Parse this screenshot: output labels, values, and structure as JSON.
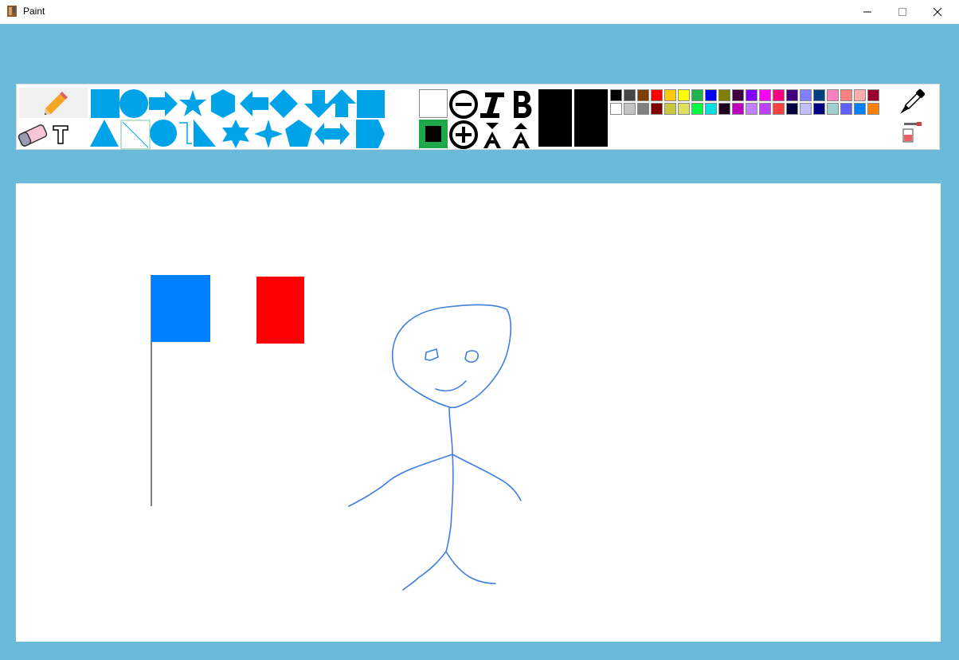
{
  "window": {
    "title": "Paint"
  },
  "colors": {
    "accent": "#00a2e8",
    "canvas_bg": "#ffffff",
    "app_bg": "#6cbad9",
    "flag_blue": "#0080ff",
    "flag_red": "#ff0000",
    "stroke_blue": "#3f7fe0",
    "selected_border": "#1fa84a"
  },
  "toolbar": {
    "tools": [
      "pencil-icon",
      "eraser-icon",
      "text-icon"
    ],
    "shapes_row1": [
      "rectangle",
      "ellipse",
      "right-arrow",
      "star-5",
      "hexagon",
      "left-arrow",
      "diamond",
      "down-arrow",
      "up-arrow",
      "square"
    ],
    "shapes_row2": [
      "triangle",
      "line",
      "oval",
      "polyline",
      "right-triangle",
      "star-6",
      "star-4",
      "pentagon",
      "double-arrow",
      "arrow-pentagon"
    ],
    "font_controls": [
      "zoom-out-icon",
      "italic-icon",
      "bold-icon",
      "zoom-in-icon",
      "font-decrease-icon",
      "font-increase-icon"
    ],
    "primary_color": "#000000",
    "secondary_color": "#ffffff",
    "palette_row1": [
      "#000000",
      "#464646",
      "#7f3f00",
      "#ff0000",
      "#ffc90e",
      "#ffff00",
      "#22b14c",
      "#0000ff",
      "#808000",
      "#400040",
      "#8000ff",
      "#ff00ff",
      "#ff0080",
      "#400080",
      "#7f7fff",
      "#004080",
      "#ff80c0",
      "#ff8080",
      "#ffaeae",
      "#990030"
    ],
    "palette_row2": [
      "#ffffff",
      "#c3c3c3",
      "#808080",
      "#7f0000",
      "#c8c840",
      "#e0e060",
      "#00ff40",
      "#00e0e0",
      "#200020",
      "#c000c0",
      "#c080ff",
      "#c040ff",
      "#ff4040",
      "#000040",
      "#c0c0ff",
      "#000080",
      "#a0d0d0",
      "#6060ff",
      "#0080ff",
      "#ff8000"
    ],
    "right_tools": [
      "eyedropper-icon",
      "paint-bucket-icon"
    ]
  }
}
